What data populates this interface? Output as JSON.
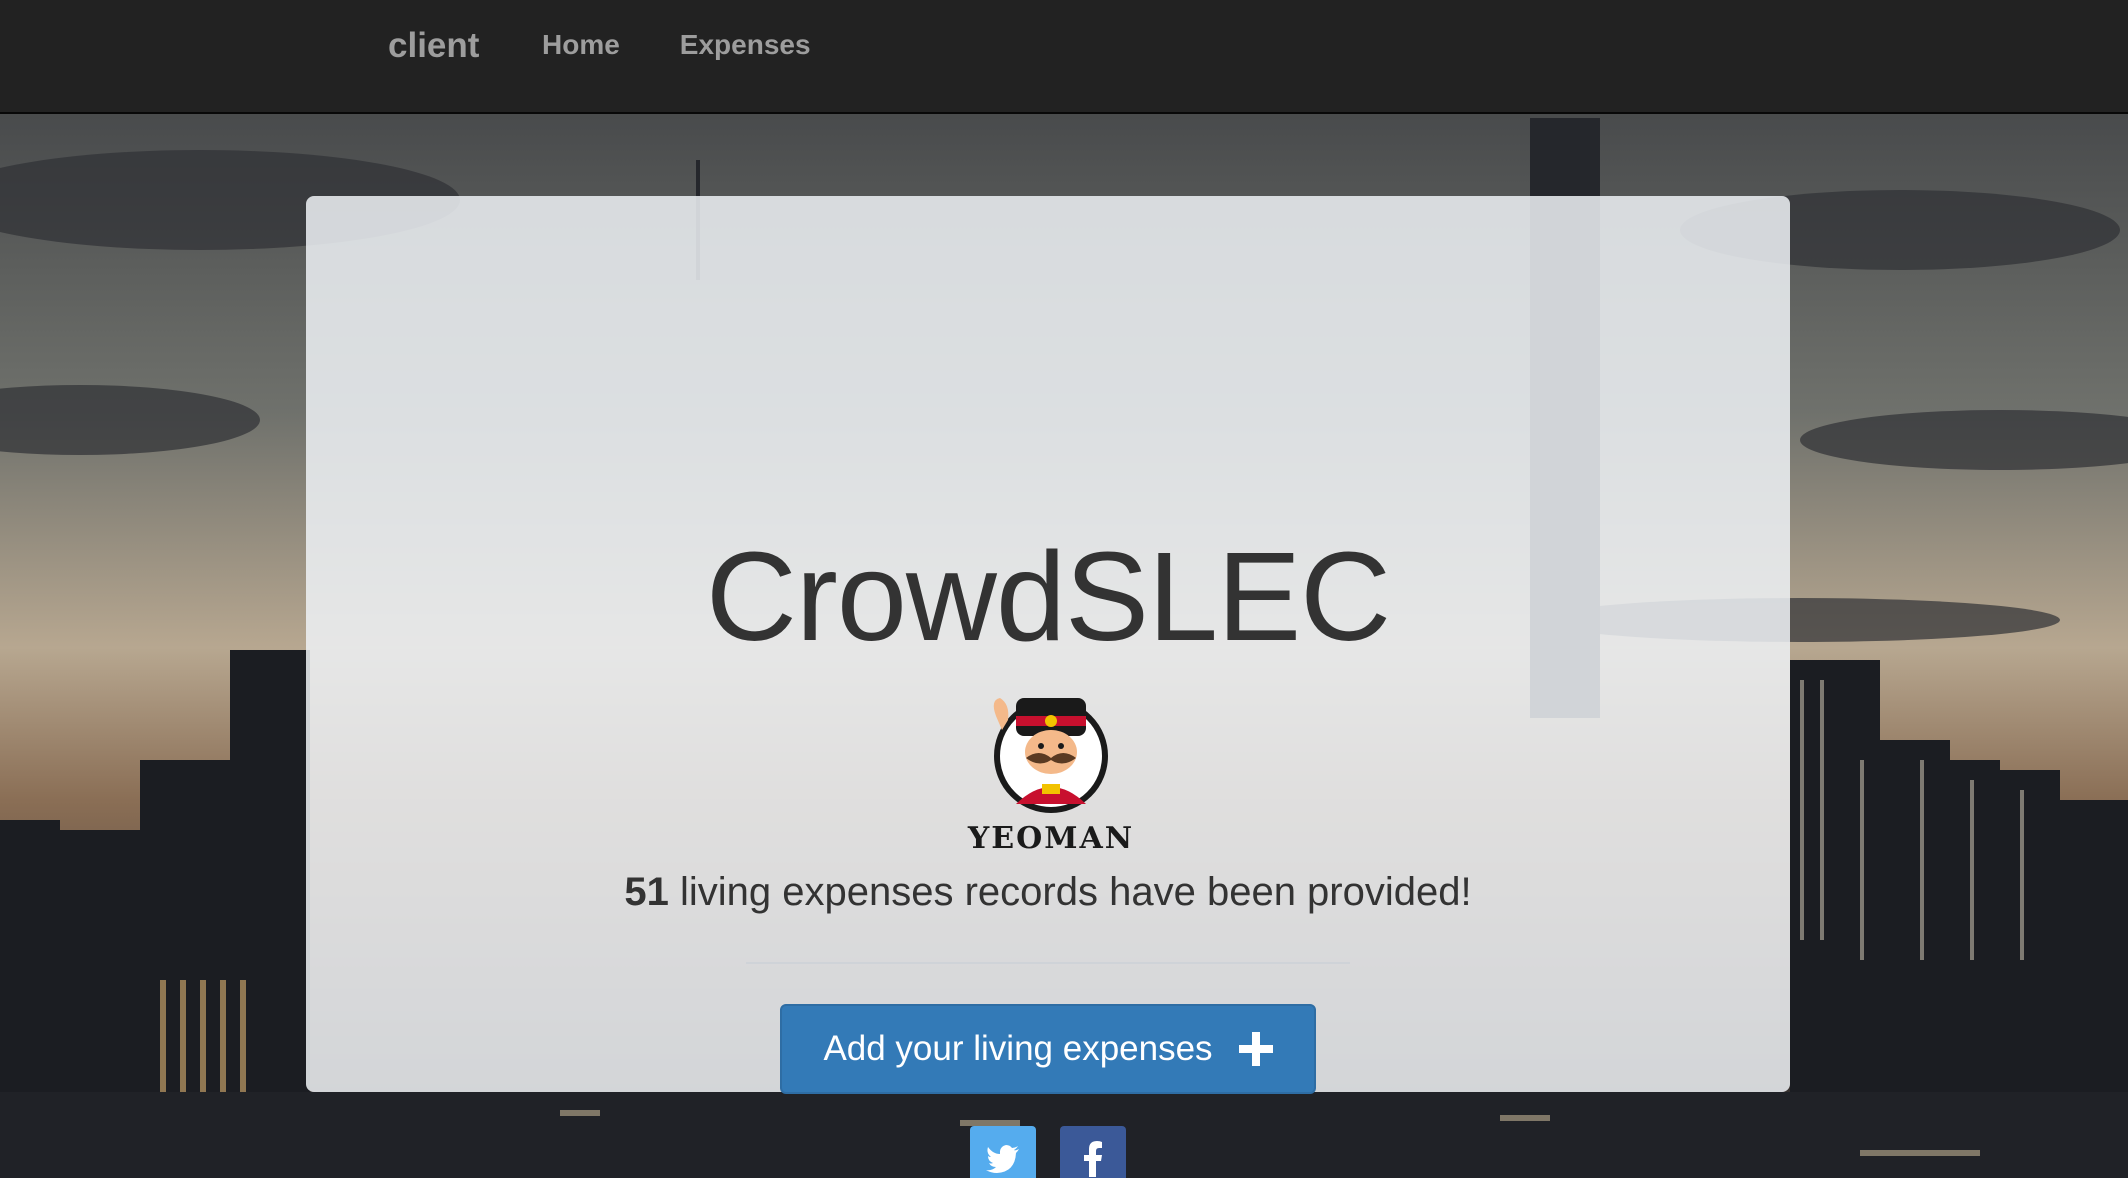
{
  "navbar": {
    "brand": "client",
    "links": [
      "Home",
      "Expenses"
    ]
  },
  "hero": {
    "title": "CrowdSLEC",
    "logo_text": "YEOMAN",
    "record_count": "51",
    "record_text": "living expenses records have been provided!",
    "add_button_label": "Add your living expenses",
    "add_button_icon": "plus-icon",
    "social_icons": [
      "twitter-icon",
      "facebook-icon"
    ]
  },
  "colors": {
    "navbar_bg": "#222222",
    "nav_text": "#9d9d9d",
    "primary": "#337ab7",
    "twitter": "#55acee",
    "facebook": "#3b5998",
    "title_text": "#333333"
  }
}
